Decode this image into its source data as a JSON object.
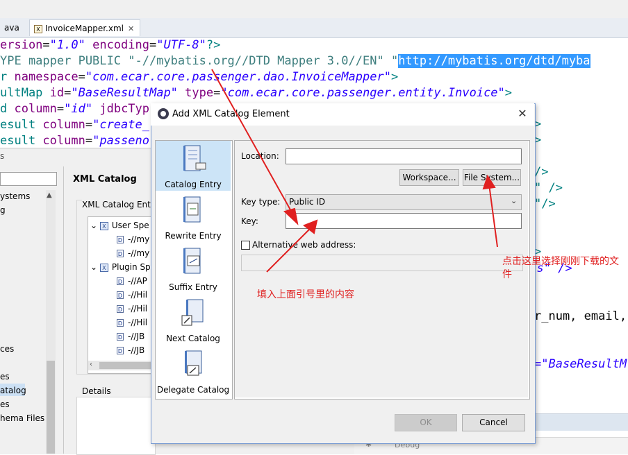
{
  "tabs": {
    "java_tab_label": "ava",
    "xml_tab_label": "InvoiceMapper.xml",
    "xml_tab_close": "✕"
  },
  "code": {
    "line1": [
      {
        "t": "ersion",
        "c": "at"
      },
      {
        "t": "=",
        "c": "tx"
      },
      {
        "t": "\"1.0\"",
        "c": "val"
      },
      {
        "t": " ",
        "c": "tx"
      },
      {
        "t": "encoding",
        "c": "at"
      },
      {
        "t": "=",
        "c": "tx"
      },
      {
        "t": "\"UTF-8\"",
        "c": "val"
      },
      {
        "t": "?>",
        "c": "br"
      }
    ],
    "line2": [
      {
        "t": "YPE mapper PUBLIC ",
        "c": "kw"
      },
      {
        "t": "\"-//mybatis.org//DTD Mapper 3.0//EN\"",
        "c": "kw"
      },
      {
        "t": " \"",
        "c": "kw"
      },
      {
        "t": "http://mybatis.org/dtd/myba",
        "c": "hl"
      }
    ],
    "line3": [
      {
        "t": "r ",
        "c": "br"
      },
      {
        "t": "namespace",
        "c": "at"
      },
      {
        "t": "=",
        "c": "tx"
      },
      {
        "t": "\"com.ecar.core.passenger.dao.InvoiceMapper\"",
        "c": "val"
      },
      {
        "t": ">",
        "c": "br"
      }
    ],
    "line4": [
      {
        "t": "ultMap ",
        "c": "br"
      },
      {
        "t": "id",
        "c": "at"
      },
      {
        "t": "=",
        "c": "tx"
      },
      {
        "t": "\"BaseResultMap\"",
        "c": "val"
      },
      {
        "t": " ",
        "c": "tx"
      },
      {
        "t": "type",
        "c": "at"
      },
      {
        "t": "=",
        "c": "tx"
      },
      {
        "t": "\"com.ecar.core.passenger.entity.Invoice\"",
        "c": "val"
      },
      {
        "t": ">",
        "c": "br"
      }
    ],
    "line5": [
      {
        "t": "d ",
        "c": "br"
      },
      {
        "t": "column",
        "c": "at"
      },
      {
        "t": "=",
        "c": "tx"
      },
      {
        "t": "\"id\"",
        "c": "val"
      },
      {
        "t": " ",
        "c": "tx"
      },
      {
        "t": "jdbcTyp",
        "c": "at"
      }
    ],
    "line6": [
      {
        "t": "esult ",
        "c": "br"
      },
      {
        "t": "column",
        "c": "at"
      },
      {
        "t": "=",
        "c": "tx"
      },
      {
        "t": "\"create_",
        "c": "val"
      }
    ],
    "line7": [
      {
        "t": "esult ",
        "c": "br"
      },
      {
        "t": "column",
        "c": "at"
      },
      {
        "t": "=",
        "c": "tx"
      },
      {
        "t": "\"passeno",
        "c": "val"
      }
    ],
    "r1": "/>",
    "r2": "\" />",
    "r3": "\"/>",
    "r4": "ess\" />",
    "r5": "r_num, email,",
    "r6": "=\"BaseResultM",
    "r7": "/>",
    "r8": "/>",
    "r9": ">"
  },
  "prefs": {
    "filter_value": "",
    "nav_items": [
      "ystems",
      "g",
      "ces",
      "es",
      "atalog",
      "es",
      "hema Files"
    ],
    "page_title": "XML Catalog",
    "group_title": "XML Catalog Ent",
    "tree": {
      "user_root": "User Spe",
      "user_children": [
        "-//my",
        "-//my"
      ],
      "plugin_root": "Plugin Sp",
      "plugin_children": [
        "-//AP",
        "-//Hil",
        "-//Hil",
        "-//Hil",
        "-//JB",
        "-//JB"
      ]
    },
    "details_label": "Details"
  },
  "bottom": {
    "debug_label": "Debug"
  },
  "dialog": {
    "title": "Add XML Catalog Element",
    "close_glyph": "✕",
    "sidebar": [
      {
        "label": "Catalog Entry",
        "selected": true
      },
      {
        "label": "Rewrite Entry",
        "selected": false
      },
      {
        "label": "Suffix Entry",
        "selected": false
      },
      {
        "label": "Next Catalog",
        "selected": false
      },
      {
        "label": "Delegate Catalog",
        "selected": false
      }
    ],
    "location_label": "Location:",
    "location_value": "",
    "workspace_button": "Workspace...",
    "filesystem_button": "File System...",
    "key_type_label": "Key type:",
    "key_type_value": "Public ID",
    "key_label": "Key:",
    "key_value": "",
    "alt_web_label": "Alternative web address:",
    "alt_web_checked": false,
    "ok_button": "OK",
    "cancel_button": "Cancel"
  },
  "annotations": {
    "fill_key": "填入上面引号里的内容",
    "click_file_system": "点击这里选择刚刚下载的文件",
    "color": "#e02020"
  }
}
